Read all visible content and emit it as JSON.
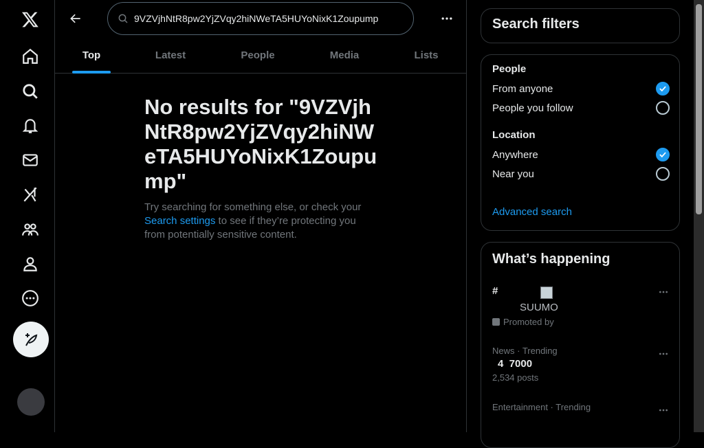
{
  "search": {
    "query": "9VZVjhNtR8pw2YjZVqy2hiNWeTA5HUYoNixK1Zoupump"
  },
  "tabs": [
    {
      "label": "Top"
    },
    {
      "label": "Latest"
    },
    {
      "label": "People"
    },
    {
      "label": "Media"
    },
    {
      "label": "Lists"
    }
  ],
  "empty": {
    "title": "No results for \"9VZVjhNtR8pw2YjZVqy2hiNWeTA5HUYoNixK1Zoupump\"",
    "text_before": "Try searching for something else, or check your ",
    "link": "Search settings",
    "text_after": " to see if they’re protecting you from potentially sensitive content."
  },
  "filters": {
    "title": "Search filters",
    "people_label": "People",
    "from_anyone": "From anyone",
    "people_you_follow": "People you follow",
    "location_label": "Location",
    "anywhere": "Anywhere",
    "near_you": "Near you",
    "advanced": "Advanced search"
  },
  "happening": {
    "title": "What’s happening",
    "promo_hash": "#",
    "promo_brand": "SUUMO",
    "promo_label": "Promoted by",
    "trend2_meta": "News · Trending",
    "trend2_name": "4  7000",
    "trend2_count": "2,534 posts",
    "trend3_meta": "Entertainment · Trending"
  },
  "colors": {
    "accent": "#1d9bf0",
    "background": "#000000",
    "border": "#2f3336",
    "muted_text": "#71767b"
  }
}
